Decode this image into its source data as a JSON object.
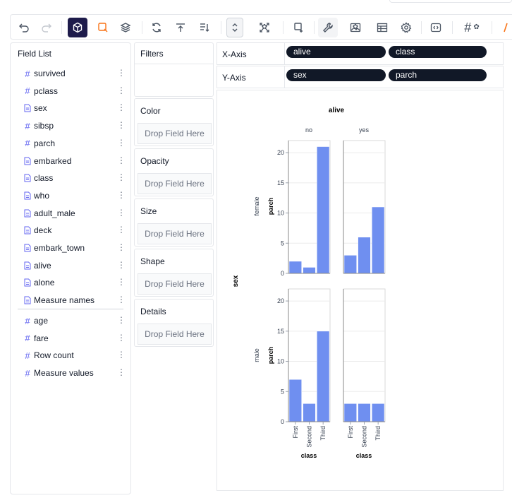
{
  "toolbar": {
    "icons": [
      "undo-icon",
      "redo-icon",
      "cube-icon",
      "brush-icon",
      "layers-icon",
      "refresh-icon",
      "sort-ascending-icon",
      "sort-descending-icon",
      "expand-icon",
      "scale-icon",
      "gear-icon",
      "brush-tool-icon",
      "wrench-icon",
      "image-icon",
      "table-icon",
      "settings-icon",
      "code-icon",
      "hash-icon"
    ]
  },
  "field_list": {
    "title": "Field List",
    "dimensions": [
      {
        "name": "survived",
        "icon": "hash-icon"
      },
      {
        "name": "pclass",
        "icon": "hash-icon"
      },
      {
        "name": "sex",
        "icon": "document-icon"
      },
      {
        "name": "sibsp",
        "icon": "hash-icon"
      },
      {
        "name": "parch",
        "icon": "hash-icon"
      },
      {
        "name": "embarked",
        "icon": "document-icon"
      },
      {
        "name": "class",
        "icon": "document-icon"
      },
      {
        "name": "who",
        "icon": "document-icon"
      },
      {
        "name": "adult_male",
        "icon": "document-icon"
      },
      {
        "name": "deck",
        "icon": "document-icon"
      },
      {
        "name": "embark_town",
        "icon": "document-icon"
      },
      {
        "name": "alive",
        "icon": "document-icon"
      },
      {
        "name": "alone",
        "icon": "document-icon"
      },
      {
        "name": "Measure names",
        "icon": "document-icon"
      }
    ],
    "measures": [
      {
        "name": "age",
        "icon": "hash-icon"
      },
      {
        "name": "fare",
        "icon": "hash-icon"
      },
      {
        "name": "Row count",
        "icon": "hash-icon"
      },
      {
        "name": "Measure values",
        "icon": "hash-icon"
      }
    ]
  },
  "encodings": {
    "filters": "Filters",
    "color": "Color",
    "opacity": "Opacity",
    "size": "Size",
    "shape": "Shape",
    "details": "Details",
    "drop_placeholder": "Drop Field Here"
  },
  "shelves": {
    "x_axis": {
      "label": "X-Axis",
      "fields": [
        "alive",
        "class"
      ]
    },
    "y_axis": {
      "label": "Y-Axis",
      "fields": [
        "sex",
        "parch"
      ]
    }
  },
  "chart_data": {
    "type": "bar",
    "column_facet": {
      "title": "alive",
      "values": [
        "no",
        "yes"
      ]
    },
    "row_facet": {
      "title": "sex",
      "values": [
        "female",
        "male"
      ]
    },
    "categories": [
      "First",
      "Second",
      "Third"
    ],
    "xlabel": "class",
    "ylabel": "parch",
    "ylim": [
      0,
      22
    ],
    "yticks": [
      0,
      5,
      10,
      15,
      20
    ],
    "bar_color": "#6f8ff0",
    "panels": [
      {
        "row": "female",
        "col": "no",
        "values": [
          2,
          1,
          21
        ]
      },
      {
        "row": "female",
        "col": "yes",
        "values": [
          3,
          6,
          11
        ]
      },
      {
        "row": "male",
        "col": "no",
        "values": [
          7,
          3,
          15
        ]
      },
      {
        "row": "male",
        "col": "yes",
        "values": [
          3,
          3,
          3
        ]
      }
    ]
  }
}
